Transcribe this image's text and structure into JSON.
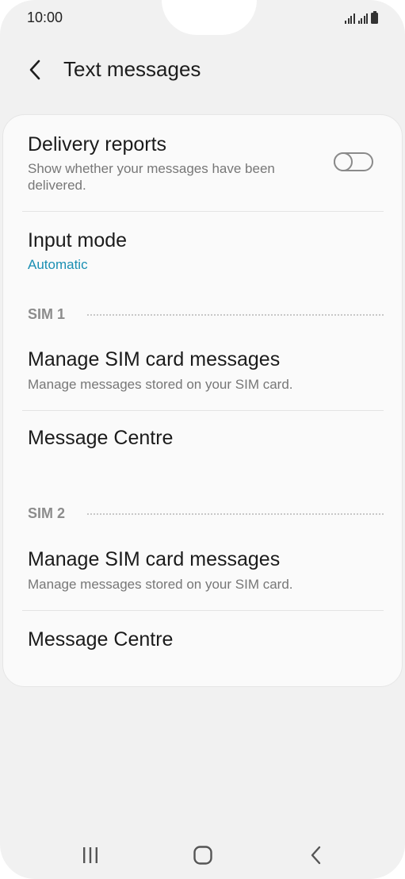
{
  "status_bar": {
    "time": "10:00",
    "icons": [
      "signal-sim1-icon",
      "signal-sim2-icon",
      "battery-icon"
    ]
  },
  "header": {
    "back_icon": "chevron-left-icon",
    "title": "Text messages"
  },
  "settings": {
    "delivery_reports": {
      "title": "Delivery reports",
      "subtitle": "Show whether your messages have been delivered.",
      "toggle_on": false
    },
    "input_mode": {
      "title": "Input mode",
      "value": "Automatic"
    },
    "sim1": {
      "header": "SIM 1",
      "manage": {
        "title": "Manage SIM card messages",
        "subtitle": "Manage messages stored on your SIM card."
      },
      "centre": {
        "title": "Message Centre"
      }
    },
    "sim2": {
      "header": "SIM 2",
      "manage": {
        "title": "Manage SIM card messages",
        "subtitle": "Manage messages stored on your SIM card."
      },
      "centre": {
        "title": "Message Centre"
      }
    }
  },
  "colors": {
    "accent_value": "#1a8fb3",
    "background": "#f1f1f1",
    "card": "#fafafa"
  },
  "nav_bar": {
    "icons": [
      "recent-apps-icon",
      "home-icon",
      "back-icon"
    ]
  }
}
